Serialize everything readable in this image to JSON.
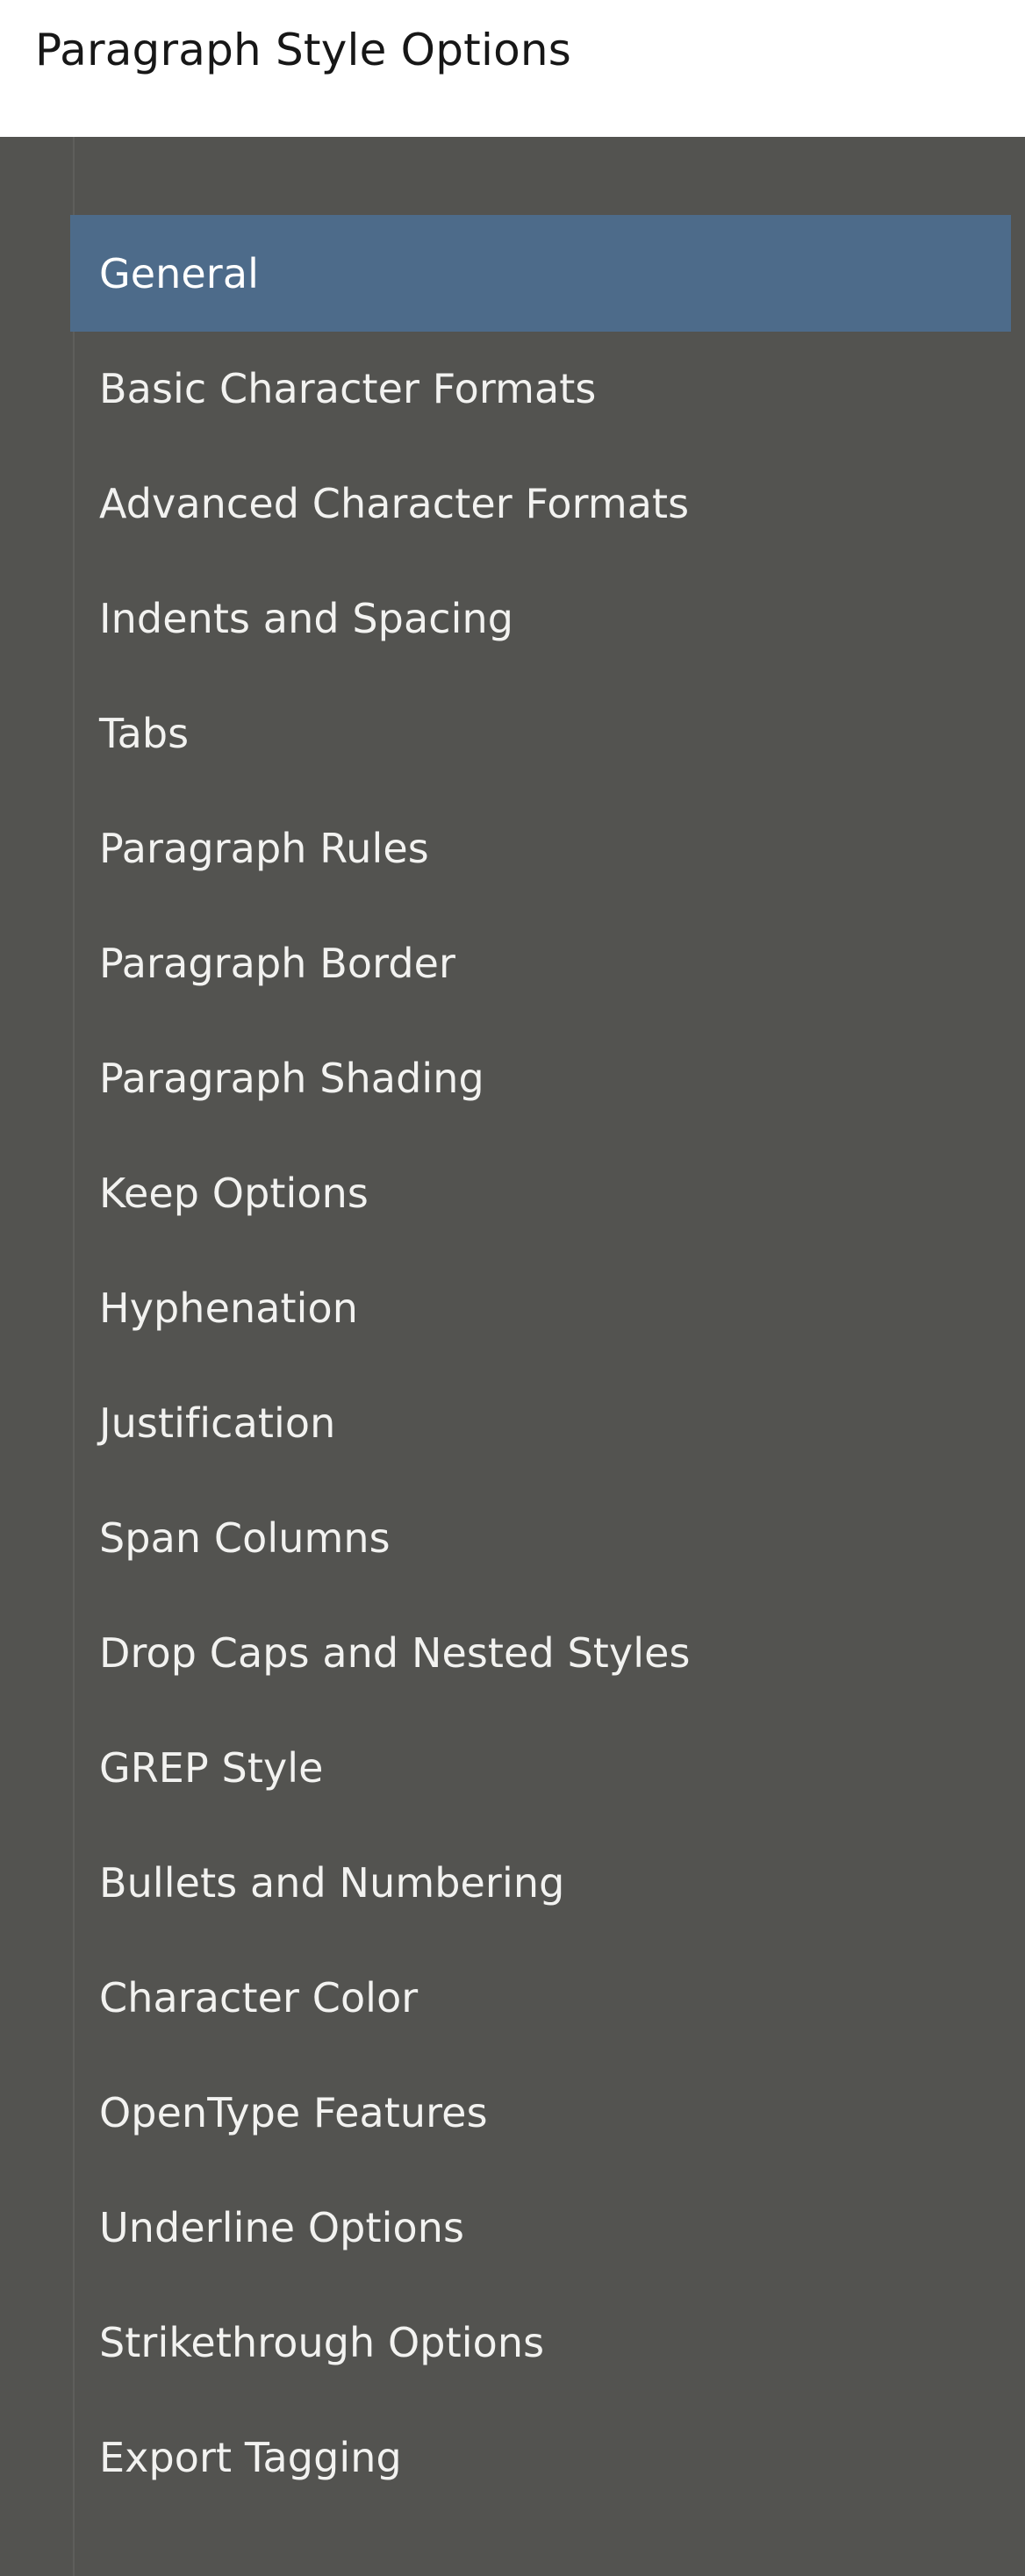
{
  "dialog": {
    "title": "Paragraph Style Options",
    "colors": {
      "titlebar_background": "#ffffff",
      "titlebar_text": "#171717",
      "panel_background": "#535350",
      "panel_divider": "#5e5e5b",
      "selection_background": "#4d6b8a",
      "item_text": "#f2f2f0",
      "selected_item_text": "#ffffff"
    }
  },
  "category_list": {
    "selected_index": 0,
    "items": [
      {
        "label": "General"
      },
      {
        "label": "Basic Character Formats"
      },
      {
        "label": "Advanced Character Formats"
      },
      {
        "label": "Indents and Spacing"
      },
      {
        "label": "Tabs"
      },
      {
        "label": "Paragraph Rules"
      },
      {
        "label": "Paragraph Border"
      },
      {
        "label": "Paragraph Shading"
      },
      {
        "label": "Keep Options"
      },
      {
        "label": "Hyphenation"
      },
      {
        "label": "Justification"
      },
      {
        "label": "Span Columns"
      },
      {
        "label": "Drop Caps and Nested Styles"
      },
      {
        "label": "GREP Style"
      },
      {
        "label": "Bullets and Numbering"
      },
      {
        "label": "Character Color"
      },
      {
        "label": "OpenType Features"
      },
      {
        "label": "Underline Options"
      },
      {
        "label": "Strikethrough Options"
      },
      {
        "label": "Export Tagging"
      }
    ]
  }
}
